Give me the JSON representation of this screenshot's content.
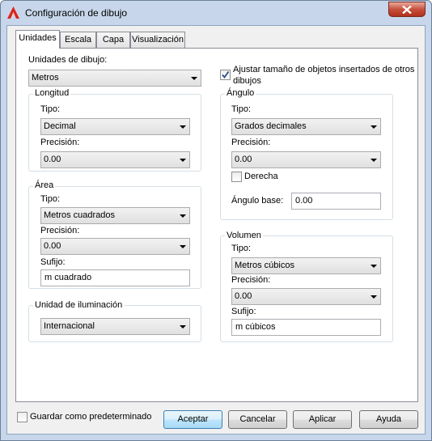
{
  "window": {
    "title": "Configuración de dibujo",
    "icon": "autocad-a-icon",
    "accent": "#c7d6ea"
  },
  "tabs": [
    {
      "label": "Unidades",
      "active": true
    },
    {
      "label": "Escala",
      "active": false
    },
    {
      "label": "Capa",
      "active": false
    },
    {
      "label": "Visualización",
      "active": false
    }
  ],
  "units": {
    "label": "Unidades de dibujo:",
    "value": "Metros"
  },
  "adjust_checkbox": {
    "checked": true,
    "label_line1": "Ajustar tamaño de objetos insertados de otros",
    "label_line2": "dibujos"
  },
  "longitud": {
    "title": "Longitud",
    "type_label": "Tipo:",
    "type_value": "Decimal",
    "precision_label": "Precisión:",
    "precision_value": "0.00"
  },
  "angulo": {
    "title": "Ángulo",
    "type_label": "Tipo:",
    "type_value": "Grados decimales",
    "precision_label": "Precisión:",
    "precision_value": "0.00",
    "derecha_label": "Derecha",
    "derecha_checked": false,
    "base_label": "Ángulo base:",
    "base_value": "0.00"
  },
  "area": {
    "title": "Área",
    "type_label": "Tipo:",
    "type_value": "Metros cuadrados",
    "precision_label": "Precisión:",
    "precision_value": "0.00",
    "suffix_label": "Sufijo:",
    "suffix_value": "m cuadrado"
  },
  "volumen": {
    "title": "Volumen",
    "type_label": "Tipo:",
    "type_value": "Metros cúbicos",
    "precision_label": "Precisión:",
    "precision_value": "0.00",
    "suffix_label": "Sufijo:",
    "suffix_value": "m cúbicos"
  },
  "iluminacion": {
    "title": "Unidad de iluminación",
    "value": "Internacional"
  },
  "footer": {
    "save_default_label": "Guardar como predeterminado",
    "save_default_checked": false,
    "accept_label": "Aceptar",
    "cancel_label": "Cancelar",
    "apply_label": "Aplicar",
    "help_label": "Ayuda"
  }
}
